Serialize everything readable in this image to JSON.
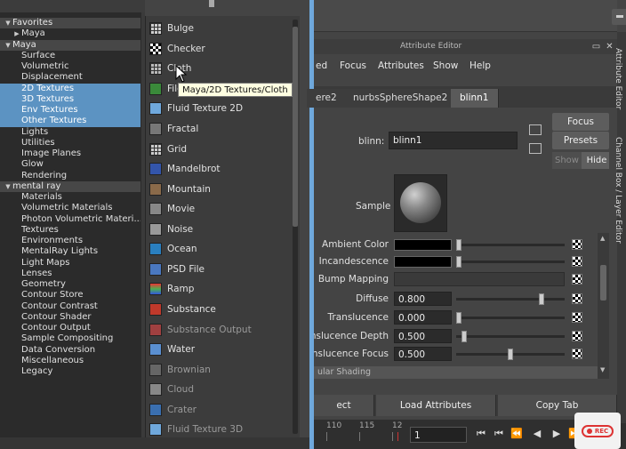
{
  "tree": {
    "items": [
      {
        "label": "Favorites",
        "kind": "header",
        "arrow": "▼"
      },
      {
        "label": "Maya",
        "kind": "child",
        "arrow": "▶"
      },
      {
        "label": "Maya",
        "kind": "header",
        "arrow": "▼"
      },
      {
        "label": "Surface",
        "kind": "item"
      },
      {
        "label": "Volumetric",
        "kind": "item"
      },
      {
        "label": "Displacement",
        "kind": "item"
      },
      {
        "label": "2D Textures",
        "kind": "item",
        "selected": true
      },
      {
        "label": "3D Textures",
        "kind": "item",
        "selected": true
      },
      {
        "label": "Env Textures",
        "kind": "item",
        "selected": true
      },
      {
        "label": "Other Textures",
        "kind": "item",
        "selected": true
      },
      {
        "label": "Lights",
        "kind": "item"
      },
      {
        "label": "Utilities",
        "kind": "item"
      },
      {
        "label": "Image Planes",
        "kind": "item"
      },
      {
        "label": "Glow",
        "kind": "item"
      },
      {
        "label": "Rendering",
        "kind": "item"
      },
      {
        "label": "mental ray",
        "kind": "header",
        "arrow": "▼"
      },
      {
        "label": "Materials",
        "kind": "item"
      },
      {
        "label": "Volumetric Materials",
        "kind": "item"
      },
      {
        "label": "Photon Volumetric Materi...",
        "kind": "item"
      },
      {
        "label": "Textures",
        "kind": "item"
      },
      {
        "label": "Environments",
        "kind": "item"
      },
      {
        "label": "MentalRay Lights",
        "kind": "item"
      },
      {
        "label": "Light Maps",
        "kind": "item"
      },
      {
        "label": "Lenses",
        "kind": "item"
      },
      {
        "label": "Geometry",
        "kind": "item"
      },
      {
        "label": "Contour Store",
        "kind": "item"
      },
      {
        "label": "Contour Contrast",
        "kind": "item"
      },
      {
        "label": "Contour Shader",
        "kind": "item"
      },
      {
        "label": "Contour Output",
        "kind": "item"
      },
      {
        "label": "Sample Compositing",
        "kind": "item"
      },
      {
        "label": "Data Conversion",
        "kind": "item"
      },
      {
        "label": "Miscellaneous",
        "kind": "item"
      },
      {
        "label": "Legacy",
        "kind": "item"
      }
    ]
  },
  "nodes": {
    "items": [
      {
        "label": "Bulge",
        "icon": "bulge-icon",
        "color": "#cfcfcf",
        "pattern": "grid"
      },
      {
        "label": "Checker",
        "icon": "checker-icon",
        "color": "#ffffff",
        "pattern": "checker"
      },
      {
        "label": "Cloth",
        "icon": "cloth-icon",
        "color": "#bbbbbb",
        "pattern": "grid"
      },
      {
        "label": "File",
        "icon": "file-icon",
        "color": "#3a8a3a",
        "pattern": "solid"
      },
      {
        "label": "Fluid Texture 2D",
        "icon": "fluid-texture-2d-icon",
        "color": "#6fa8dc",
        "pattern": "solid"
      },
      {
        "label": "Fractal",
        "icon": "fractal-icon",
        "color": "#777777",
        "pattern": "solid"
      },
      {
        "label": "Grid",
        "icon": "grid-icon",
        "color": "#cccccc",
        "pattern": "grid"
      },
      {
        "label": "Mandelbrot",
        "icon": "mandelbrot-icon",
        "color": "#3355aa",
        "pattern": "solid"
      },
      {
        "label": "Mountain",
        "icon": "mountain-icon",
        "color": "#8a6a4a",
        "pattern": "solid"
      },
      {
        "label": "Movie",
        "icon": "movie-icon",
        "color": "#888888",
        "pattern": "solid"
      },
      {
        "label": "Noise",
        "icon": "noise-icon",
        "color": "#999999",
        "pattern": "solid"
      },
      {
        "label": "Ocean",
        "icon": "ocean-icon",
        "color": "#2a7fbf",
        "pattern": "solid"
      },
      {
        "label": "PSD File",
        "icon": "psd-file-icon",
        "color": "#4a78c0",
        "pattern": "solid"
      },
      {
        "label": "Ramp",
        "icon": "ramp-icon",
        "color": "#4caf50",
        "pattern": "ramp"
      },
      {
        "label": "Substance",
        "icon": "substance-icon",
        "color": "#c0392b",
        "pattern": "solid"
      },
      {
        "label": "Substance Output",
        "icon": "substance-output-icon",
        "color": "#a04040",
        "pattern": "solid",
        "dim": true
      },
      {
        "label": "Water",
        "icon": "water-icon",
        "color": "#5a8fd0",
        "pattern": "solid"
      },
      {
        "label": "Brownian",
        "icon": "brownian-icon",
        "color": "#666666",
        "pattern": "solid",
        "dim": true
      },
      {
        "label": "Cloud",
        "icon": "cloud-icon",
        "color": "#888888",
        "pattern": "solid",
        "dim": true
      },
      {
        "label": "Crater",
        "icon": "crater-icon",
        "color": "#3a6fb0",
        "pattern": "solid",
        "dim": true
      },
      {
        "label": "Fluid Texture 3D",
        "icon": "fluid-texture-3d-icon",
        "color": "#6fa8dc",
        "pattern": "solid",
        "dim": true
      }
    ]
  },
  "tooltip": "Maya/2D Textures/Cloth",
  "attribute_editor": {
    "title": "Attribute Editor",
    "menu": [
      "ed",
      "Focus",
      "Attributes",
      "Show",
      "Help"
    ],
    "tabs": [
      {
        "label": "ere2",
        "active": false
      },
      {
        "label": "nurbsSphereShape2",
        "active": false
      },
      {
        "label": "blinn1",
        "active": true
      }
    ],
    "node_label": "blinn:",
    "node_name": "blinn1",
    "focus_label": "Focus",
    "presets_label": "Presets",
    "show_label": "Show",
    "hide_label": "Hide",
    "sample_label": "Sample",
    "attributes": [
      {
        "label": "Ambient Color",
        "type": "color",
        "color": "#000000",
        "slider": 0.0
      },
      {
        "label": "Incandescence",
        "type": "color",
        "color": "#000000",
        "slider": 0.0
      },
      {
        "label": "Bump Mapping",
        "type": "wide"
      },
      {
        "label": "Diffuse",
        "type": "number",
        "value": "0.800",
        "slider": 0.8
      },
      {
        "label": "Translucence",
        "type": "number",
        "value": "0.000",
        "slider": 0.0
      },
      {
        "label": "nslucence Depth",
        "type": "number",
        "value": "0.500",
        "slider": 0.05
      },
      {
        "label": "nslucence Focus",
        "type": "number",
        "value": "0.500",
        "slider": 0.5
      }
    ],
    "section": "ular Shading",
    "buttons": [
      "ect",
      "Load Attributes",
      "Copy Tab"
    ]
  },
  "timeline": {
    "ticks": [
      "110",
      "115",
      "12"
    ],
    "frame": "1"
  },
  "side_tabs": [
    "Attribute Editor",
    "Channel Box / Layer Editor"
  ],
  "rec_badge": "REC"
}
